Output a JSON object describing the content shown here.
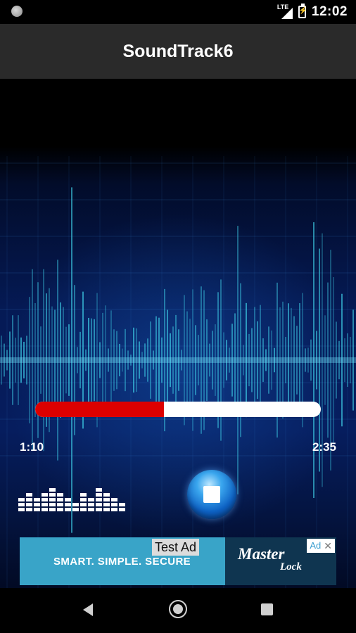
{
  "status_bar": {
    "network": "LTE",
    "time": "12:02"
  },
  "app_bar": {
    "title": "SoundTrack6"
  },
  "player": {
    "progress": 0.45,
    "current_time": "1:10",
    "total_time": "2:35",
    "stop_icon": "stop-square-icon",
    "equalizer_icon": "equalizer-icon"
  },
  "ad": {
    "label": "Test Ad",
    "slogan": "SMART. SIMPLE. SECURE",
    "brand": "Master",
    "brand_sub": "Lock",
    "choices_label": "Ad",
    "close_glyph": "✕"
  },
  "colors": {
    "progress_fill": "#dd0000",
    "progress_track": "#ffffff",
    "wave": "#3fd0e8",
    "ad_background": "#39a4c8"
  },
  "nav_bar": {
    "back_icon": "back-triangle-icon",
    "home_icon": "home-circle-icon",
    "recents_icon": "recents-square-icon"
  }
}
